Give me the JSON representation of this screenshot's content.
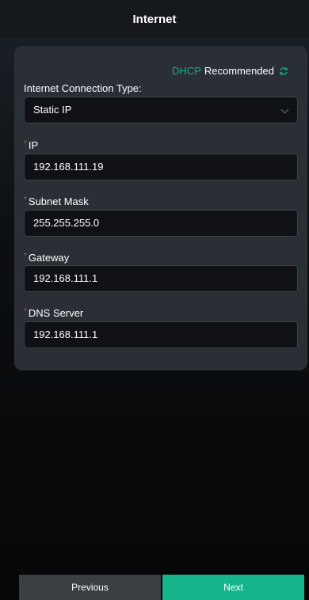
{
  "header": {
    "title": "Internet"
  },
  "recommend": {
    "protocol": "DHCP",
    "word": "Recommended",
    "icon": "refresh-icon",
    "accent": "#14b28a"
  },
  "connection": {
    "label": "Internet Connection Type:",
    "value": "Static IP"
  },
  "fields": [
    {
      "required": "*",
      "label": "IP",
      "value": "192.168.111.19"
    },
    {
      "required": "*",
      "label": "Subnet Mask",
      "value": "255.255.255.0"
    },
    {
      "required": "*",
      "label": "Gateway",
      "value": "192.168.111.1"
    },
    {
      "required": "*",
      "label": "DNS Server",
      "value": "192.168.111.1"
    }
  ],
  "footer": {
    "previous": "Previous",
    "next": "Next"
  }
}
